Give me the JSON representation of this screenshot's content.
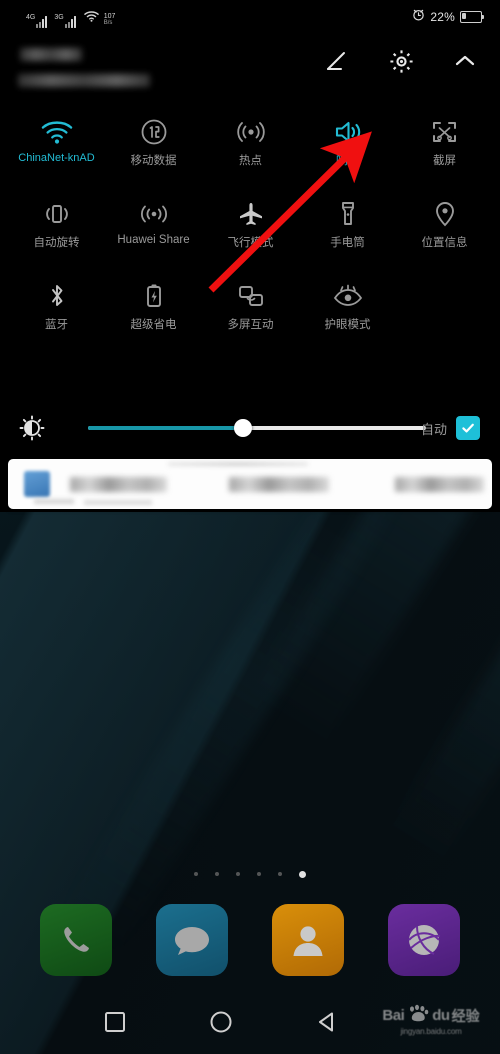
{
  "status_bar": {
    "signal_1_gen": "4G",
    "signal_2_gen": "3G",
    "network_speed_value": "107",
    "network_speed_unit": "B/s",
    "alarm_icon": "alarm-clock-icon",
    "wifi_icon": "wifi-icon",
    "battery_percent": "22%",
    "battery_icon": "battery-icon"
  },
  "panel_header": {
    "carrier_text_redacted": "",
    "date_text_redacted": "",
    "edit_icon": "edit-pencil-icon",
    "settings_icon": "gear-icon",
    "collapse_icon": "chevron-up-icon"
  },
  "tiles": [
    {
      "label": "ChinaNet-knAD",
      "icon": "wifi-icon",
      "active": true
    },
    {
      "label": "移动数据",
      "icon": "mobile-data-icon",
      "active": false
    },
    {
      "label": "热点",
      "icon": "hotspot-icon",
      "active": false
    },
    {
      "label": "响铃",
      "icon": "sound-ring-icon",
      "active": true
    },
    {
      "label": "截屏",
      "icon": "screenshot-icon",
      "active": false
    },
    {
      "label": "自动旋转",
      "icon": "auto-rotate-icon",
      "active": false
    },
    {
      "label": "Huawei Share",
      "icon": "huawei-share-icon",
      "active": false
    },
    {
      "label": "飞行模式",
      "icon": "airplane-mode-icon",
      "active": false
    },
    {
      "label": "手电筒",
      "icon": "flashlight-icon",
      "active": false
    },
    {
      "label": "位置信息",
      "icon": "location-pin-icon",
      "active": false
    },
    {
      "label": "蓝牙",
      "icon": "bluetooth-icon",
      "active": false
    },
    {
      "label": "超级省电",
      "icon": "super-power-saving-icon",
      "active": false
    },
    {
      "label": "多屏互动",
      "icon": "multi-screen-icon",
      "active": false
    },
    {
      "label": "护眼模式",
      "icon": "eye-comfort-icon",
      "active": false
    }
  ],
  "brightness": {
    "icon": "brightness-icon",
    "value_percent": 46,
    "auto_label": "自动",
    "auto_checked": true,
    "checkbox_icon": "checkmark-icon"
  },
  "notification": {
    "app_icon": "app-icon-blurred",
    "content_redacted": "",
    "visible": true
  },
  "annotation": {
    "arrow_icon": "red-arrow-icon",
    "color": "#f01010",
    "points_to": "响铃"
  },
  "home_screen": {
    "page_dots_total": 6,
    "page_dots_active_index": 5,
    "dock_apps": [
      {
        "label_icon": "phone-icon",
        "color": "#1d6b22"
      },
      {
        "label_icon": "messages-icon",
        "color": "#1b6f8e"
      },
      {
        "label_icon": "contacts-icon",
        "color": "#d98f0a"
      },
      {
        "label_icon": "browser-icon",
        "color": "#6a2d9e"
      }
    ]
  },
  "navigation_bar": {
    "recents_icon": "square-recents-icon",
    "home_icon": "circle-home-icon",
    "back_icon": "triangle-back-icon"
  },
  "watermark": {
    "brand": "Bai",
    "brand_suffix": "du",
    "brand_cn": "经验",
    "url": "jingyan.baidu.com",
    "paw_icon": "paw-print-icon"
  },
  "colors": {
    "accent_cyan": "#23bcd4",
    "slider_fill": "#1897a8",
    "arrow_red": "#f01010",
    "label_gray": "#9a9a9a"
  }
}
